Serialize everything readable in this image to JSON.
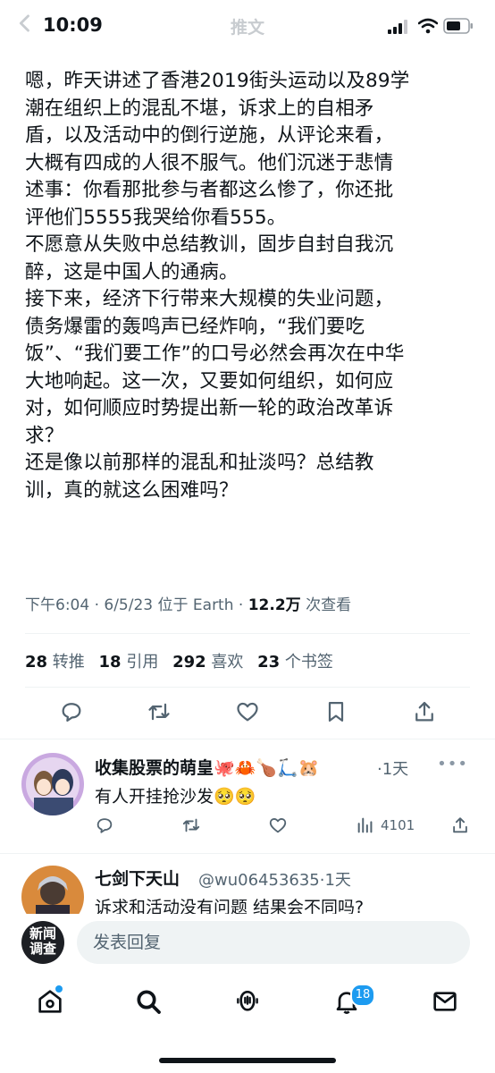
{
  "status_bar": {
    "time": "10:09"
  },
  "header": {
    "title": "推文"
  },
  "tweet": {
    "text": "嗯，昨天讲述了香港2019街头运动以及89学\n潮在组织上的混乱不堪，诉求上的自相矛\n盾，以及活动中的倒行逆施，从评论来看，\n大概有四成的人很不服气。他们沉迷于悲情\n述事：你看那批参与者都这么惨了，你还批\n评他们5555我哭给你看555。\n不愿意从失败中总结教训，固步自封自我沉\n醉，这是中国人的通病。\n接下来，经济下行带来大规模的失业问题，\n债务爆雷的轰鸣声已经炸响，“我们要吃\n饭”、“我们要工作”的口号必然会再次在中华\n大地响起。这一次，又要如何组织，如何应\n对，如何顺应时势提出新一轮的政治改革诉\n求？\n还是像以前那样的混乱和扯淡吗？总结教\n训，真的就这么困难吗？",
    "meta_prefix": "下午6:04 · 6/5/23 位于 Earth · ",
    "views_count": "12.2万",
    "views_label": " 次查看",
    "stats": {
      "retweets": "28",
      "retweets_label": "转推",
      "quotes": "18",
      "quotes_label": "引用",
      "likes": "292",
      "likes_label": "喜欢",
      "bookmarks": "23",
      "bookmarks_label": "个书签"
    }
  },
  "replies": [
    {
      "name": "收集股票的萌皇",
      "emojis": "🐙🦀🍗🛴🐹",
      "time": "·1天",
      "text": "有人开挂抢沙发🥺🥺",
      "views": "4101"
    },
    {
      "name": "七剑下天山",
      "handle": "@wu06453635",
      "time": "·1天",
      "text": "诉求和活动没有问题 结果会不同吗?"
    }
  ],
  "composer": {
    "avatar_text": "新闻调查",
    "placeholder": "发表回复"
  },
  "tabbar": {
    "notifications_badge": "18"
  },
  "colors": {
    "accent": "#1d9bf0",
    "text": "#0f1419",
    "muted": "#536471"
  }
}
